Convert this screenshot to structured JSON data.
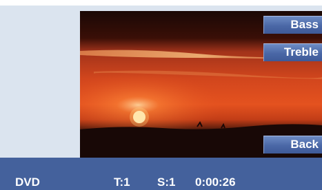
{
  "controls": {
    "bass_label": "Bass",
    "treble_label": "Treble",
    "back_label": "Back"
  },
  "status": {
    "source": "DVD",
    "track": "T:1",
    "scene": "S:1",
    "time": "0:00:26"
  },
  "colors": {
    "panel_background": "#dbe4ef",
    "button_blue": "#4a67a6",
    "status_bar": "#44619c",
    "sunset_orange": "#e4521f"
  }
}
